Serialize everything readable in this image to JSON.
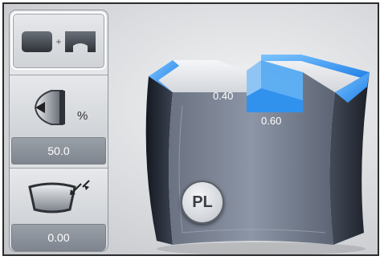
{
  "sidebar": {
    "mode_button": {
      "icon": "lens-plus-lens-icon"
    },
    "percent_button": {
      "icon": "bevel-position-icon",
      "unit": "%"
    },
    "percent_value": "50.0",
    "shape_button": {
      "icon": "lens-shape-compress-icon"
    },
    "shape_value": "0.00"
  },
  "view": {
    "depth_label": "0.40",
    "width_label": "0.60",
    "profile_button": "PL",
    "accent_color": "#1f8fff"
  }
}
